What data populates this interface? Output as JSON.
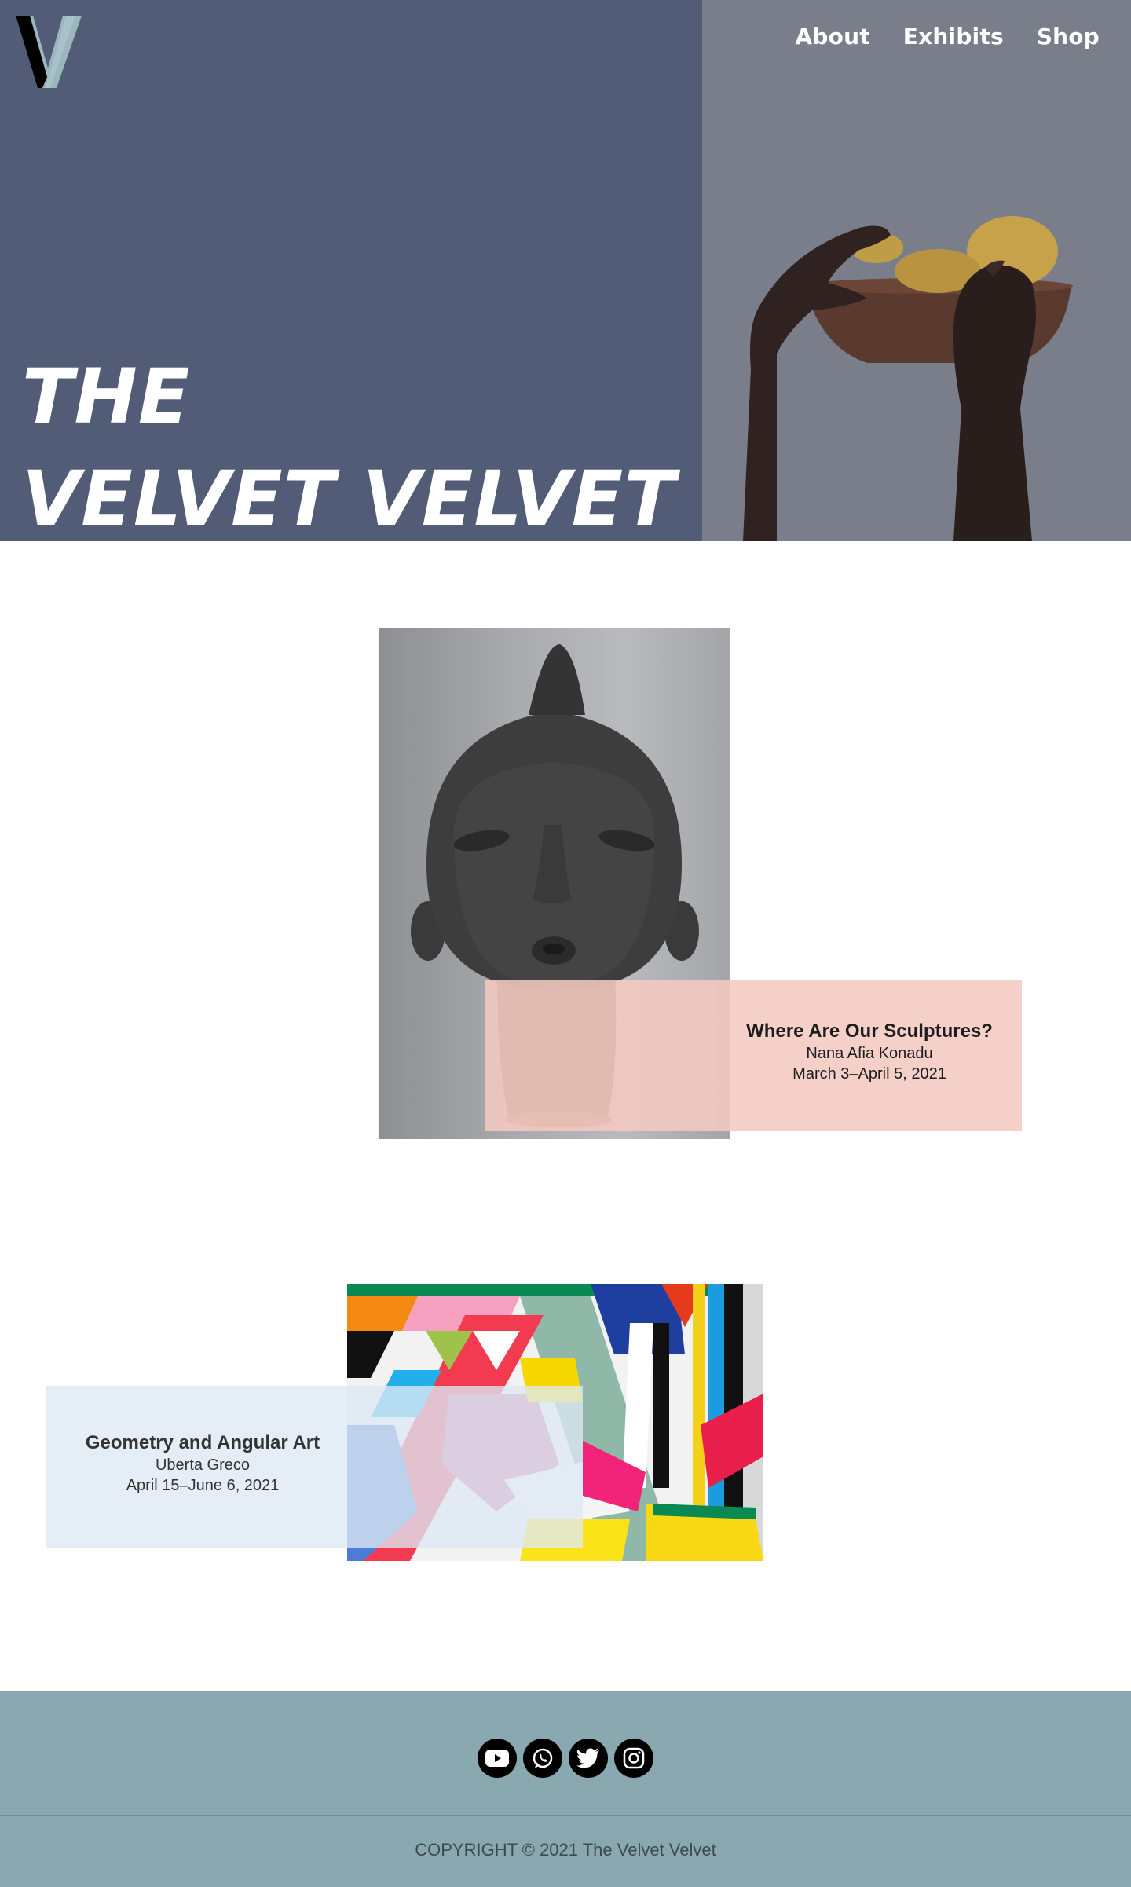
{
  "brand": {
    "logo_icon": "v-logo-icon",
    "title_line1": "THE",
    "title_line2": "VELVET VELVET",
    "colors": {
      "hero_left": "#525c77",
      "hero_right": "#7a7e8b",
      "logo_dark": "#000000",
      "logo_light": "#9bb6bd"
    }
  },
  "nav": {
    "items": [
      {
        "label": "About"
      },
      {
        "label": "Exhibits"
      },
      {
        "label": "Shop"
      }
    ]
  },
  "hero": {
    "image_icon": "hands-holding-bowl-image"
  },
  "exhibits": [
    {
      "title": "Where Are Our Sculptures?",
      "artist": "Nana Afia Konadu",
      "dates": "March 3–April 5, 2021",
      "image_icon": "sculpture-head-image",
      "card_color": "#f4cac0"
    },
    {
      "title": "Geometry and Angular Art",
      "artist": "Uberta Greco",
      "dates": "April 15–June 6, 2021",
      "image_icon": "geometric-painting-image",
      "card_color": "#dee9f3"
    }
  ],
  "footer": {
    "social": [
      {
        "icon": "youtube-icon"
      },
      {
        "icon": "whatsapp-icon"
      },
      {
        "icon": "twitter-icon"
      },
      {
        "icon": "instagram-icon"
      }
    ],
    "copyright": "COPYRIGHT © 2021 The Velvet Velvet",
    "background": "#8aa8b0"
  }
}
